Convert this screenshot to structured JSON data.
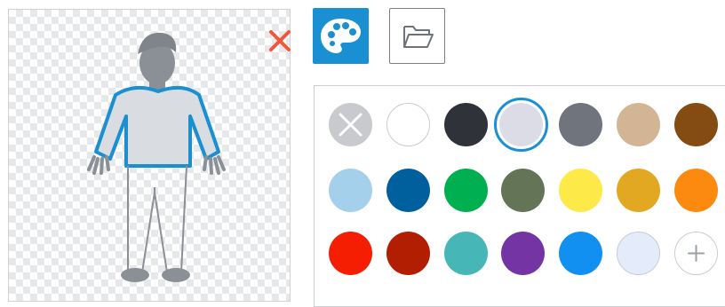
{
  "editor": {
    "tools": [
      {
        "id": "color",
        "icon": "palette-icon",
        "active": true
      },
      {
        "id": "open",
        "icon": "folder-icon",
        "active": false
      }
    ],
    "close_icon": "close-icon",
    "figure_colors": {
      "outline": "#1a8fd1",
      "sweater": "#d9dce1",
      "skin": "#8a9096",
      "legs_stroke": "#8a9096"
    }
  },
  "palette": {
    "selected": "#dcdce6",
    "rows": [
      [
        {
          "name": "no-color",
          "color": "#c9cace"
        },
        {
          "name": "white",
          "color": "#ffffff"
        },
        {
          "name": "charcoal",
          "color": "#2f3238"
        },
        {
          "name": "lavender-grey",
          "color": "#dcdce6"
        },
        {
          "name": "slate",
          "color": "#6f747d"
        },
        {
          "name": "tan",
          "color": "#d2b595"
        },
        {
          "name": "brown",
          "color": "#844c12"
        }
      ],
      [
        {
          "name": "light-blue",
          "color": "#a4d0ec"
        },
        {
          "name": "dark-blue",
          "color": "#00609e"
        },
        {
          "name": "green",
          "color": "#00b050"
        },
        {
          "name": "olive",
          "color": "#637457"
        },
        {
          "name": "yellow",
          "color": "#fde947"
        },
        {
          "name": "gold",
          "color": "#e2a822"
        },
        {
          "name": "orange",
          "color": "#fb8a0e"
        }
      ],
      [
        {
          "name": "red",
          "color": "#f51e02"
        },
        {
          "name": "dark-red",
          "color": "#b11e02"
        },
        {
          "name": "teal",
          "color": "#46b6b6"
        },
        {
          "name": "purple",
          "color": "#7434a4"
        },
        {
          "name": "bright-blue",
          "color": "#1190f1"
        },
        {
          "name": "pale-blue",
          "color": "#e4ecfc"
        },
        {
          "name": "add",
          "color": "#ffffff"
        }
      ]
    ]
  }
}
